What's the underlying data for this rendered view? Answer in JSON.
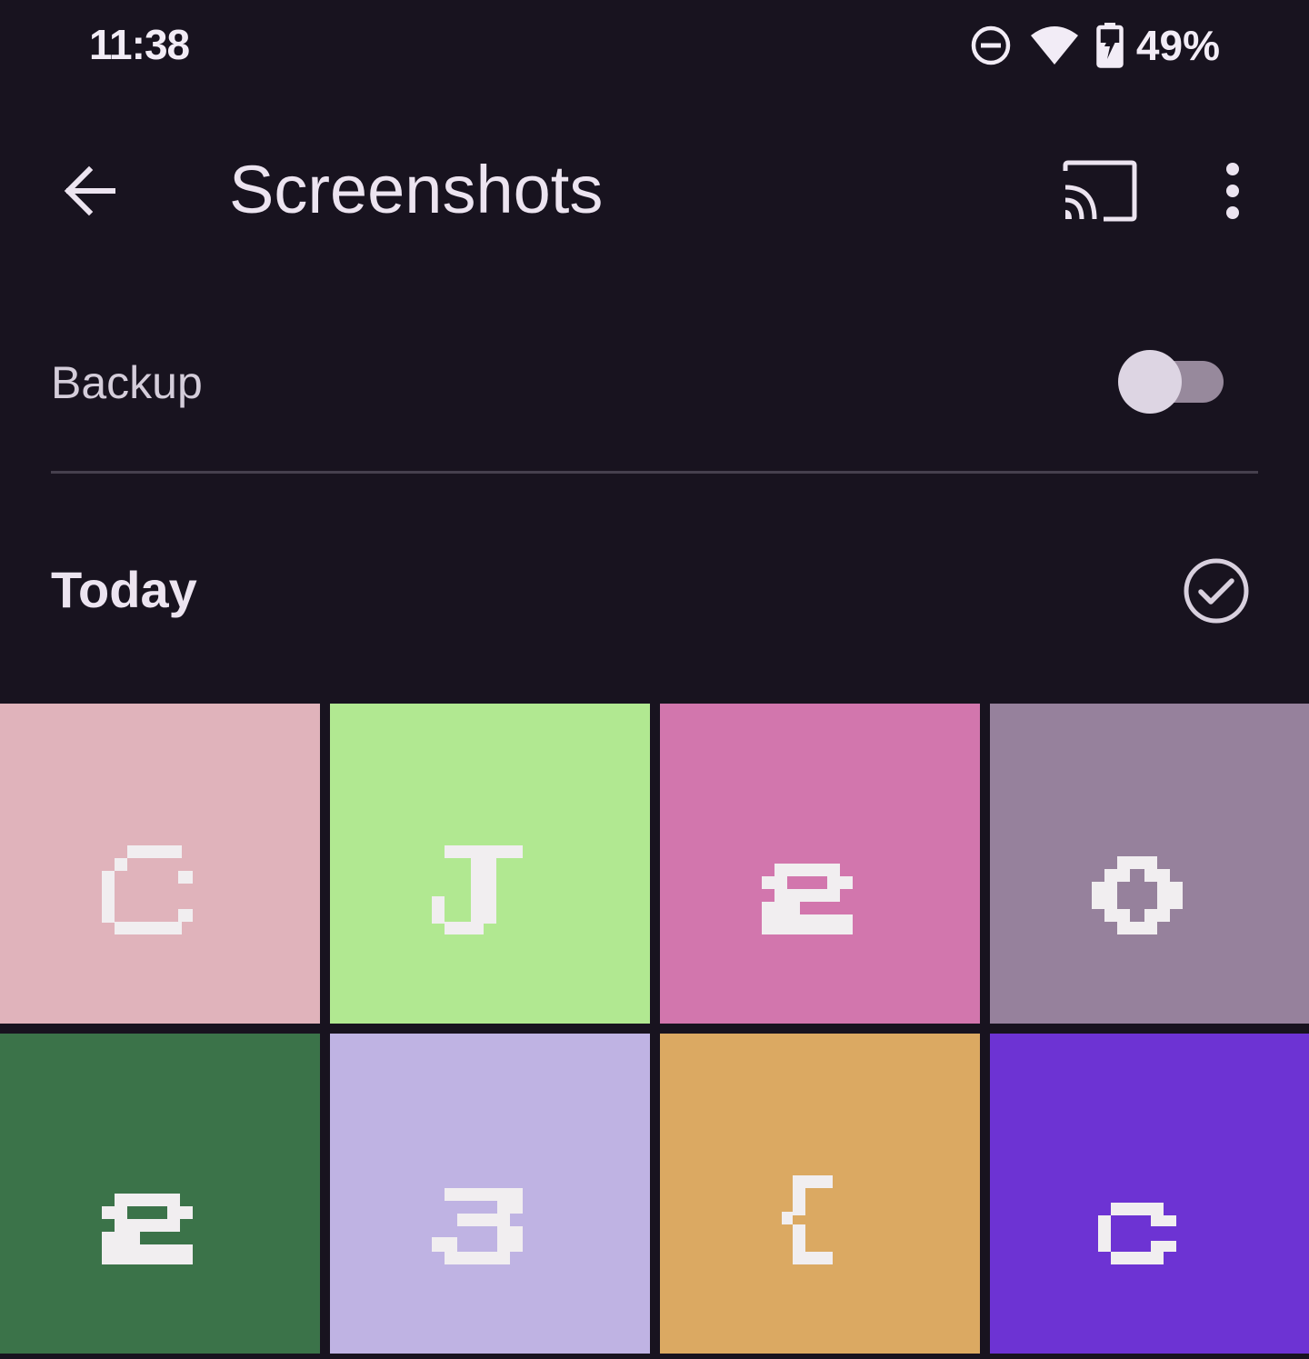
{
  "status_bar": {
    "time": "11:38",
    "battery_percent": "49%",
    "icons": [
      "do-not-disturb-icon",
      "wifi-icon",
      "battery-charging-icon"
    ]
  },
  "app_bar": {
    "title": "Screenshots",
    "icons": [
      "back-arrow-icon",
      "cast-icon",
      "more-vert-icon"
    ]
  },
  "backup": {
    "label": "Backup",
    "enabled": false
  },
  "section": {
    "title": "Today",
    "icon": "check-circle-icon"
  },
  "thumbnails": [
    {
      "glyph": "C",
      "bg": "#e0b3bb"
    },
    {
      "glyph": "J",
      "bg": "#b1e891"
    },
    {
      "glyph": "2",
      "bg": "#d276ad"
    },
    {
      "glyph": "0",
      "bg": "#96819c"
    },
    {
      "glyph": "2",
      "bg": "#3b7349"
    },
    {
      "glyph": "3",
      "bg": "#bfb3e3"
    },
    {
      "glyph": "{",
      "bg": "#dba962"
    },
    {
      "glyph": "c",
      "bg": "#6d33d3"
    }
  ],
  "colors": {
    "background": "#18131f",
    "text": "#ece4f0",
    "glyph": "#f1eef0",
    "divider": "#46404e",
    "toggle_track": "#97899c",
    "toggle_thumb": "#ddd5e3"
  }
}
